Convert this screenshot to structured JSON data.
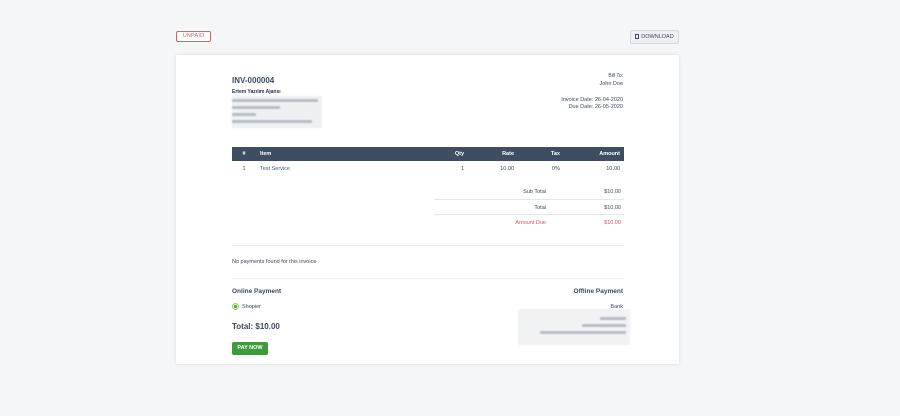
{
  "status": {
    "label": "UNPAID",
    "color": "#e85a5a"
  },
  "toolbar": {
    "download_label": "DOWNLOAD",
    "download_icon": "document-icon"
  },
  "invoice": {
    "number": "INV-000004",
    "company_name": "Ertem Yazılım Ajansı",
    "bill_to_label": "Bill To:",
    "bill_to_name": "John Doe",
    "invoice_date": "Invoice Date: 26-04-2020",
    "due_date": "Due Date: 26-05-2020"
  },
  "table": {
    "headers": [
      "#",
      "Item",
      "Qty",
      "Rate",
      "Tax",
      "Amount"
    ],
    "rows": [
      [
        "1",
        "Test Service",
        "1",
        "10.00",
        "0%",
        "10.00"
      ]
    ]
  },
  "totals": {
    "subtotal_label": "Sub Total",
    "subtotal_value": "$10.00",
    "total_label": "Total",
    "total_value": "$10.00",
    "due_label": "Amount Due",
    "due_value": "$10.00"
  },
  "payments": {
    "none_message": "No payments found for this invoice"
  },
  "online": {
    "title": "Online Payment",
    "method": "Shopier",
    "total": "Total: $10.00",
    "pay_label": "PAY NOW"
  },
  "offline": {
    "title": "Offline Payment",
    "bank": "Bank"
  },
  "colors": {
    "header_bg": "#3f4d63",
    "accent_green": "#3e9a3c",
    "due_red": "#e05555"
  }
}
